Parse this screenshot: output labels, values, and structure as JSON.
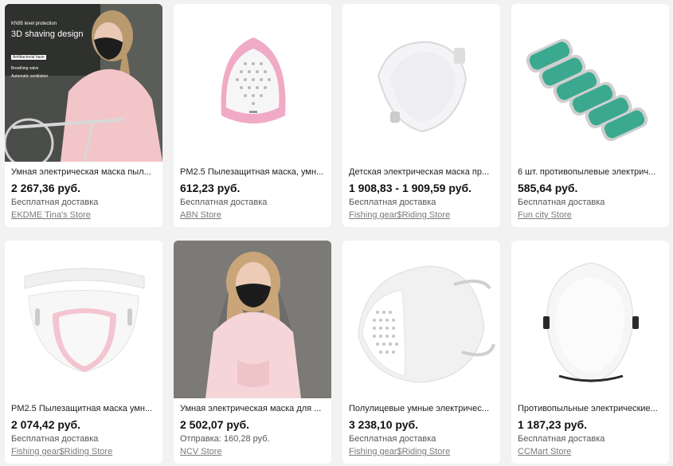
{
  "products": [
    {
      "title": "Умная электрическая маска пыл...",
      "price": "2 267,36 руб.",
      "shipping": "Бесплатная доставка",
      "store": "EKDME Tina's Store",
      "image": "woman-with-bike-mask-photo",
      "image_overlay": {
        "line1": "KN95 level protection",
        "line2": "3D shaving design",
        "line3": "Antibacterial haze",
        "line4": "Breathing valve",
        "line5": "Automatic ventilation"
      }
    },
    {
      "title": "PM2.5 Пылезащитная маска, умн...",
      "price": "612,23 руб.",
      "shipping": "Бесплатная доставка",
      "store": "ABN Store",
      "image": "pink-mask-icon"
    },
    {
      "title": "Детская электрическая маска пр...",
      "price": "1 908,83 - 1 909,59 руб.",
      "shipping": "Бесплатная доставка",
      "store": "Fishing gear$Riding Store",
      "image": "white-mask-icon"
    },
    {
      "title": "6 шт. противопылевые электрич...",
      "price": "585,64 руб.",
      "shipping": "Бесплатная доставка",
      "store": "Fun city Store",
      "image": "filter-pads-icon"
    },
    {
      "title": "PM2.5 Пылезащитная маска умн...",
      "price": "2 074,42 руб.",
      "shipping": "Бесплатная доставка",
      "store": "Fishing gear$Riding Store",
      "image": "clear-mask-icon"
    },
    {
      "title": "Умная электрическая маска для ...",
      "price": "2 502,07 руб.",
      "shipping": "Отправка: 160,28 руб.",
      "store": "NCV Store",
      "image": "woman-black-mask-photo"
    },
    {
      "title": "Полулицевые умные электричес...",
      "price": "3 238,10 руб.",
      "shipping": "Бесплатная доставка",
      "store": "Fishing gear$Riding Store",
      "image": "white-halfface-mask-icon"
    },
    {
      "title": "Противопыльные электрические...",
      "price": "1 187,23 руб.",
      "shipping": "Бесплатная доставка",
      "store": "CCMart Store",
      "image": "white-mask-front-icon"
    }
  ]
}
